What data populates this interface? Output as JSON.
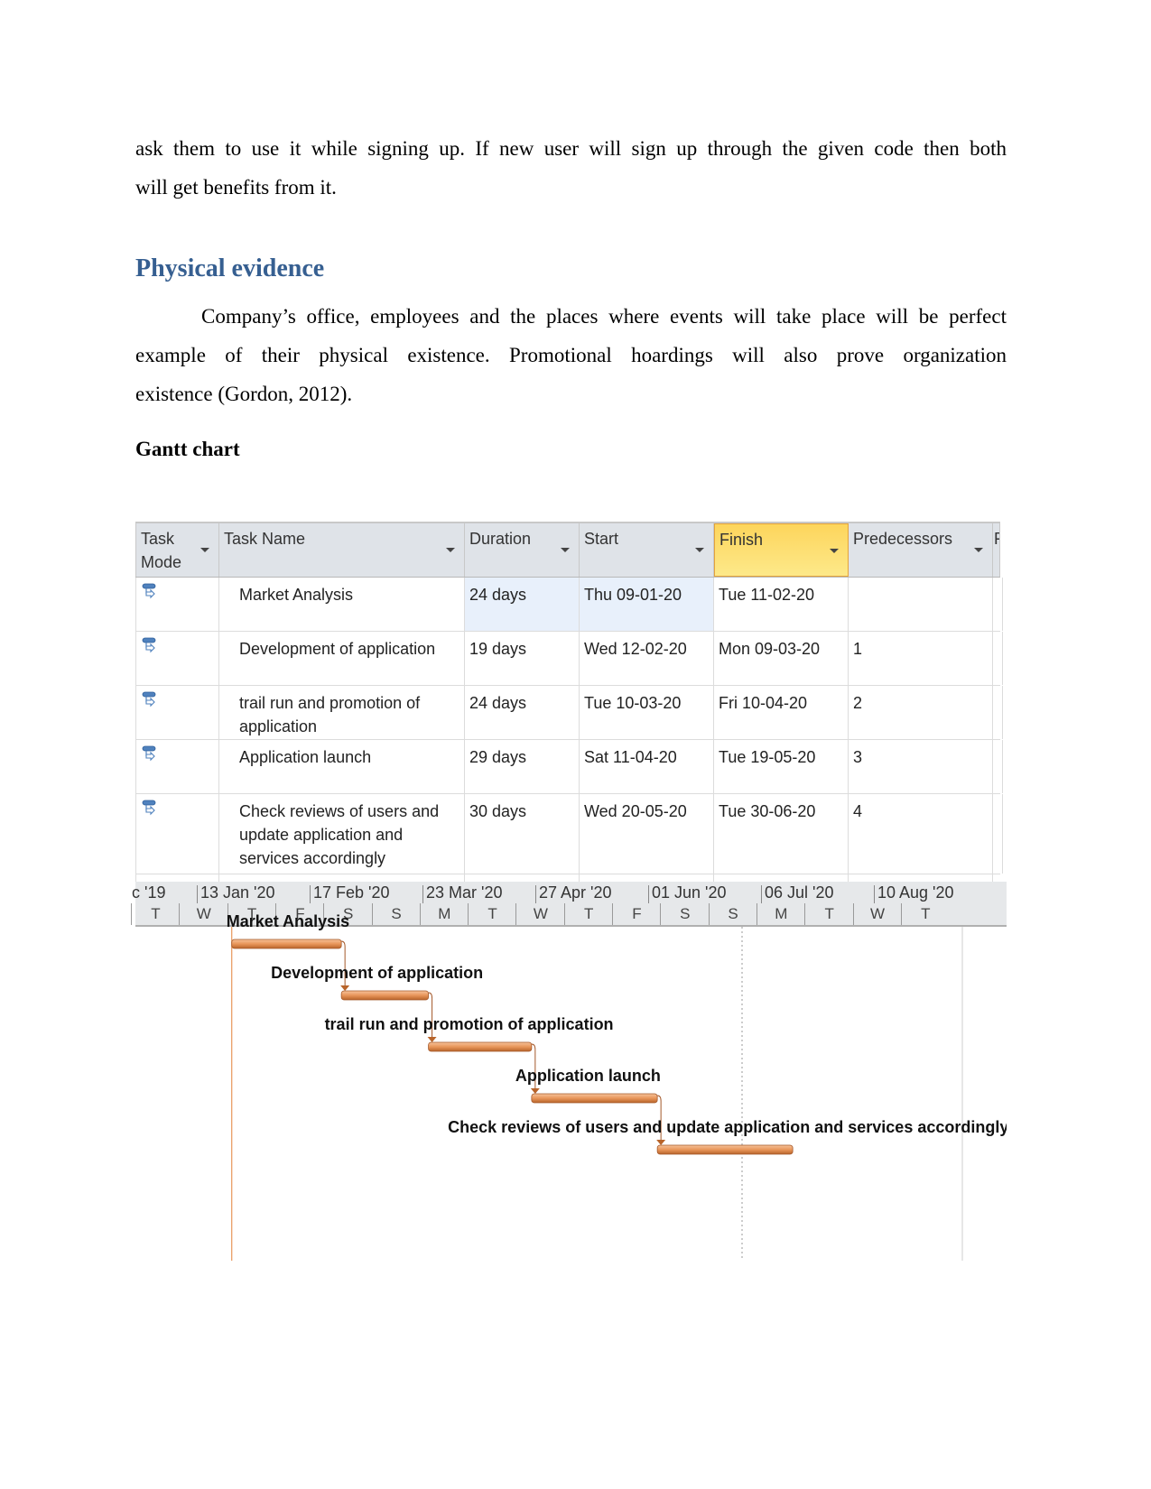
{
  "document": {
    "paragraph1_lines": [
      "ask them to use it while signing up. If new user will sign up through the given code then both",
      "will get benefits from it."
    ],
    "heading_physical_evidence": "Physical evidence",
    "paragraph2_lines": [
      "Company’s office, employees and the places where events will take place will be perfect",
      "example of their physical existence. Promotional hoardings will also prove organization",
      "existence (Gordon, 2012)."
    ],
    "heading_gantt": "Gantt chart",
    "colors": {
      "heading_blue": "#365f91",
      "bar_fill": "#e8965a",
      "finish_header": "#fdd55c"
    }
  },
  "gantt_table": {
    "columns": {
      "task_mode": "Task Mode",
      "task_name": "Task Name",
      "duration": "Duration",
      "start": "Start",
      "finish": "Finish",
      "predecessors": "Predecessors",
      "more": "F"
    },
    "rows": [
      {
        "mode_icon": "auto-schedule-icon",
        "name": "Market Analysis",
        "duration": "24 days",
        "start": "Thu 09-01-20",
        "finish": "Tue 11-02-20",
        "predecessors": ""
      },
      {
        "mode_icon": "auto-schedule-icon",
        "name": "Development of application",
        "duration": "19 days",
        "start": "Wed 12-02-20",
        "finish": "Mon 09-03-20",
        "predecessors": "1"
      },
      {
        "mode_icon": "auto-schedule-icon",
        "name": "trail run and promotion of application",
        "duration": "24 days",
        "start": "Tue 10-03-20",
        "finish": "Fri 10-04-20",
        "predecessors": "2"
      },
      {
        "mode_icon": "auto-schedule-icon",
        "name": "Application launch",
        "duration": "29 days",
        "start": "Sat 11-04-20",
        "finish": "Tue 19-05-20",
        "predecessors": "3"
      },
      {
        "mode_icon": "auto-schedule-icon",
        "name": "Check reviews of users and update application and services accordingly",
        "duration": "30 days",
        "start": "Wed 20-05-20",
        "finish": "Tue 30-06-20",
        "predecessors": "4"
      }
    ]
  },
  "timeline": {
    "top_labels": [
      "c '19",
      "13 Jan '20",
      "17 Feb '20",
      "23 Mar '20",
      "27 Apr '20",
      "01 Jun '20",
      "06 Jul '20",
      "10 Aug '20"
    ],
    "day_labels": [
      "T",
      "W",
      "T",
      "F",
      "S",
      "S",
      "M",
      "T",
      "W",
      "T",
      "F",
      "S",
      "S",
      "M",
      "T",
      "W",
      "T"
    ]
  },
  "chart_data": {
    "type": "gantt",
    "title": "Gantt chart",
    "x_axis_ticks": [
      "c '19",
      "13 Jan '20",
      "17 Feb '20",
      "23 Mar '20",
      "27 Apr '20",
      "01 Jun '20",
      "06 Jul '20",
      "10 Aug '20"
    ],
    "tasks": [
      {
        "id": 1,
        "name": "Market Analysis",
        "start": "2020-01-09",
        "finish": "2020-02-11",
        "duration_days": 24,
        "predecessor": null
      },
      {
        "id": 2,
        "name": "Development of application",
        "start": "2020-02-12",
        "finish": "2020-03-09",
        "duration_days": 19,
        "predecessor": 1
      },
      {
        "id": 3,
        "name": "trail run and promotion of application",
        "start": "2020-03-10",
        "finish": "2020-04-10",
        "duration_days": 24,
        "predecessor": 2
      },
      {
        "id": 4,
        "name": "Application launch",
        "start": "2020-04-11",
        "finish": "2020-05-19",
        "duration_days": 29,
        "predecessor": 3
      },
      {
        "id": 5,
        "name": "Check reviews of users and update application and services accordingly",
        "start": "2020-05-20",
        "finish": "2020-06-30",
        "duration_days": 30,
        "predecessor": 4
      }
    ],
    "axis_start": "2019-12-09",
    "axis_end": "2020-08-23"
  }
}
